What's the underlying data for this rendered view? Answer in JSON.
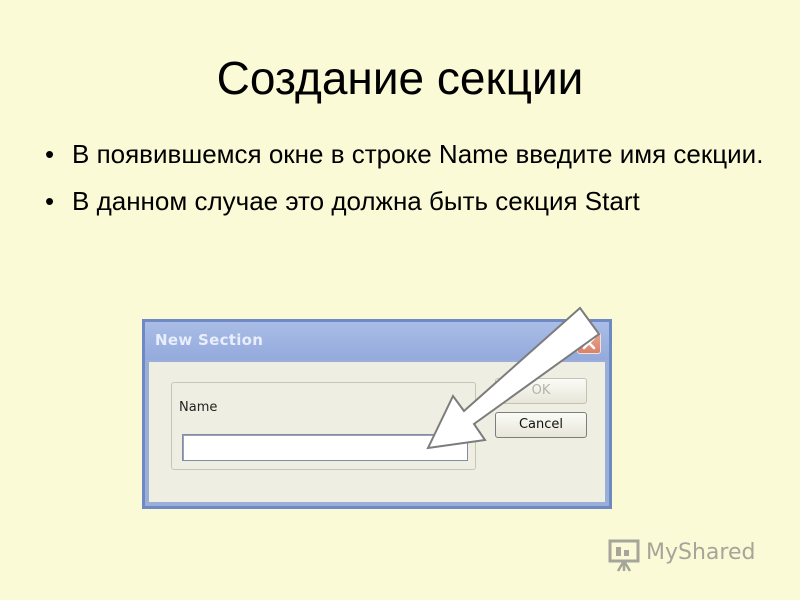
{
  "slide": {
    "title": "Создание секции",
    "bullets": [
      "В появившемся окне в строке Name введите имя секции.",
      "В данном случае это должна быть секция Start"
    ],
    "bullet_char": "•"
  },
  "dialog": {
    "title": "New Section",
    "close_icon": "close-icon",
    "name_label": "Name",
    "name_value": "",
    "ok_label": "OK",
    "ok_enabled": false,
    "cancel_label": "Cancel"
  },
  "watermark": {
    "text": "MyShared",
    "icon": "presentation-screen-icon"
  },
  "colors": {
    "background": "#fafad6",
    "title_bar": "#9aaed8",
    "close_button": "#d9826a",
    "dialog_body": "#efeee2"
  }
}
